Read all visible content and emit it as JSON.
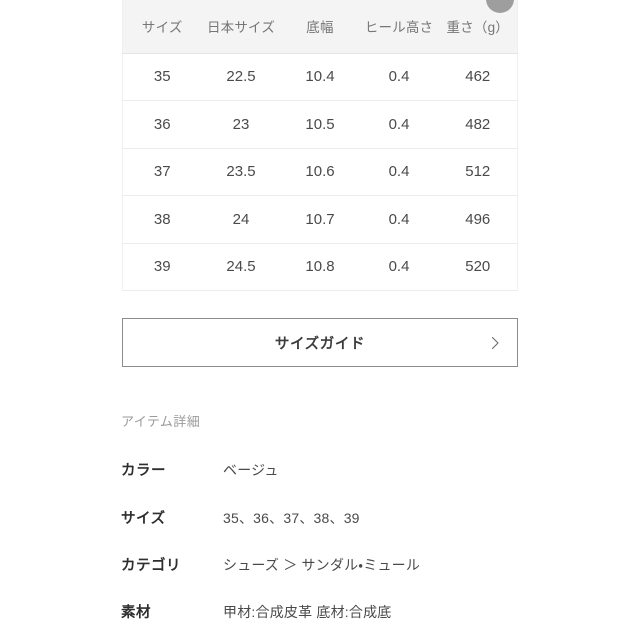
{
  "floating_button": {
    "icon": "circle-button",
    "color": "#9e9e9e"
  },
  "size_table": {
    "headers": [
      "サイズ",
      "日本サイズ",
      "底幅",
      "ヒール高さ",
      "重さ（g）"
    ],
    "rows": [
      [
        "35",
        "22.5",
        "10.4",
        "0.4",
        "462"
      ],
      [
        "36",
        "23",
        "10.5",
        "0.4",
        "482"
      ],
      [
        "37",
        "23.5",
        "10.6",
        "0.4",
        "512"
      ],
      [
        "38",
        "24",
        "10.7",
        "0.4",
        "496"
      ],
      [
        "39",
        "24.5",
        "10.8",
        "0.4",
        "520"
      ]
    ]
  },
  "size_guide": {
    "label": "サイズガイド",
    "chevron_icon": "chevron-right-icon"
  },
  "item_details": {
    "heading": "アイテム詳細",
    "rows": [
      {
        "label": "カラー",
        "value": "ベージュ"
      },
      {
        "label": "サイズ",
        "value": "35、36、37、38、39"
      },
      {
        "label": "カテゴリ",
        "value": "シューズ ＞ サンダル・ミュール"
      },
      {
        "label": "素材",
        "value": "甲材:合成皮革 底材:合成底"
      }
    ]
  }
}
